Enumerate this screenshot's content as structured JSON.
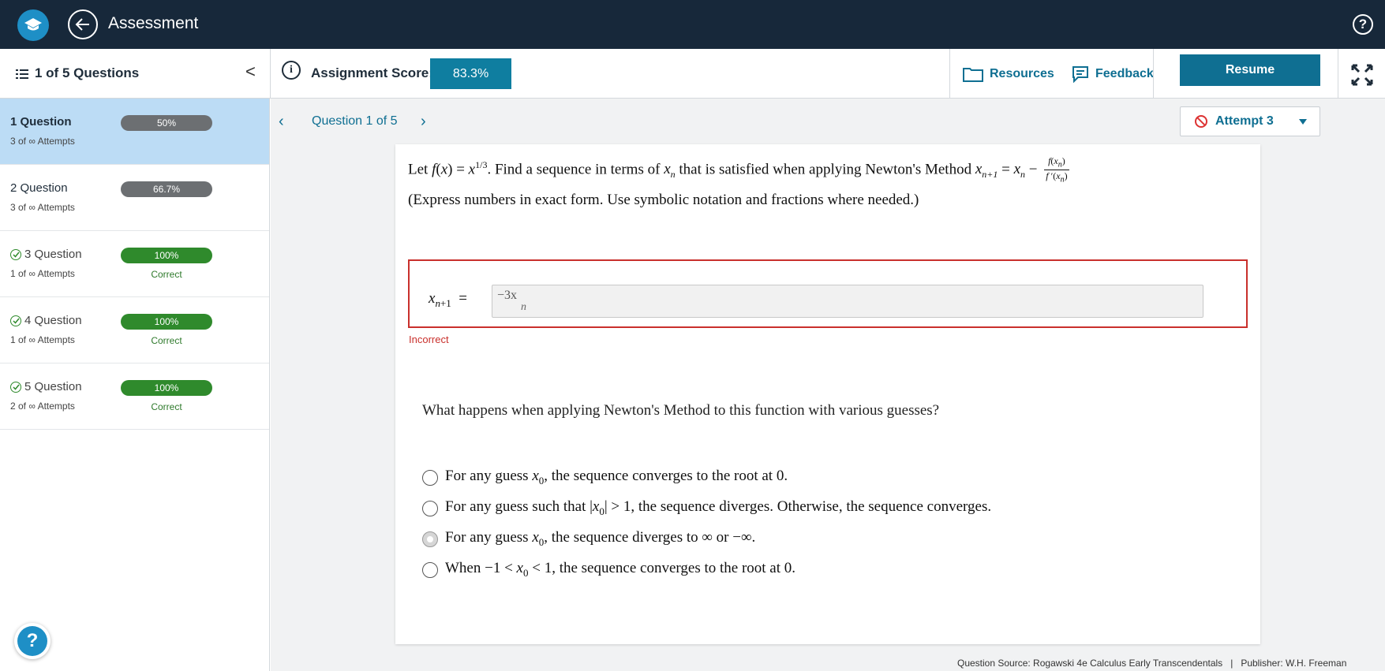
{
  "topbar": {
    "title": "Assessment",
    "logo_icon": "graduation-cap-icon",
    "help": "?"
  },
  "subheader": {
    "question_count": "1 of 5 Questions",
    "collapse": "<",
    "score_label": "Assignment Score:",
    "score_value": "83.3%",
    "resources_label": "Resources",
    "feedback_label": "Feedback",
    "resume_label": "Resume"
  },
  "sidebar": {
    "items": [
      {
        "name": "1 Question",
        "attempts": "3 of ∞ Attempts",
        "score": "50%",
        "status": "",
        "fill": 0.5
      },
      {
        "name": "2 Question",
        "attempts": "3 of ∞ Attempts",
        "score": "66.7%",
        "status": "",
        "fill": 0.667
      },
      {
        "name": "3 Question",
        "attempts": "1 of ∞ Attempts",
        "score": "100%",
        "status": "Correct",
        "fill": 1.0
      },
      {
        "name": "4 Question",
        "attempts": "1 of ∞ Attempts",
        "score": "100%",
        "status": "Correct",
        "fill": 1.0
      },
      {
        "name": "5 Question",
        "attempts": "2 of ∞ Attempts",
        "score": "100%",
        "status": "Correct",
        "fill": 1.0
      }
    ],
    "help": "?"
  },
  "main": {
    "nav_label": "Question 1 of 5",
    "attempt_label": "Attempt 3",
    "prompt_part1": "Let",
    "prompt_part2": ". Find a sequence in terms of",
    "prompt_part3": "that is satisfied when applying Newton's Method",
    "prompt_note": "(Express numbers in exact form. Use symbolic notation and fractions where needed.)",
    "answer_label": "x",
    "answer_value": "−3x",
    "answer_sub": "n",
    "answer_status": "Incorrect",
    "question2": "What happens when applying Newton's Method to this function with various guesses?",
    "selected_option": 2
  },
  "footer": {
    "source": "Question Source: Rogawski 4e Calculus Early Transcendentals",
    "separator": "|",
    "publisher": "Publisher: W.H. Freeman"
  },
  "colors": {
    "topbar": "#17283a",
    "accent": "#0f6f92",
    "correct": "#2f8a2c",
    "incorrect": "#c9302c",
    "active_row": "#bcdcf5"
  }
}
